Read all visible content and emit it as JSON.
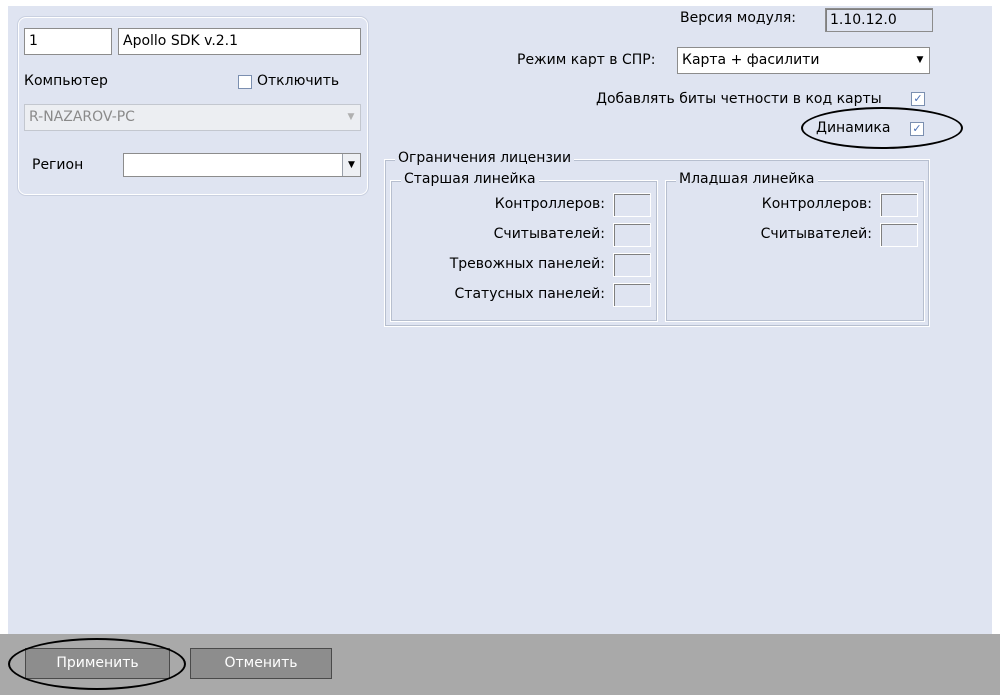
{
  "object": {
    "id_value": "1",
    "name_value": "Apollo SDK v.2.1",
    "computer_label": "Компьютер",
    "disable_label": "Отключить",
    "computer_value": "R-NAZAROV-PC",
    "region_label": "Регион",
    "region_value": ""
  },
  "settings": {
    "module_version_label": "Версия модуля:",
    "module_version_value": "1.10.12.0",
    "card_mode_label": "Режим карт в СПР:",
    "card_mode_value": "Карта + фасилити",
    "parity_label": "Добавлять биты четности в код карты",
    "parity_checked": true,
    "dynamics_label": "Динамика",
    "dynamics_checked": true
  },
  "license": {
    "title": "Ограничения лицензии",
    "senior": {
      "title": "Старшая линейка",
      "fields": [
        "Контроллеров:",
        "Считывателей:",
        "Тревожных панелей:",
        "Статусных панелей:"
      ]
    },
    "junior": {
      "title": "Младшая линейка",
      "fields": [
        "Контроллеров:",
        "Считывателей:"
      ]
    }
  },
  "buttons": {
    "apply_label": "Применить",
    "cancel_label": "Отменить"
  },
  "colors": {
    "panel_bg": "#dfe4f1",
    "bottom_bar": "#a9a9a9",
    "button_bg": "#8d8d8d"
  },
  "icons": {
    "checkbox": "check-icon",
    "dropdown": "chevron-down-icon"
  }
}
